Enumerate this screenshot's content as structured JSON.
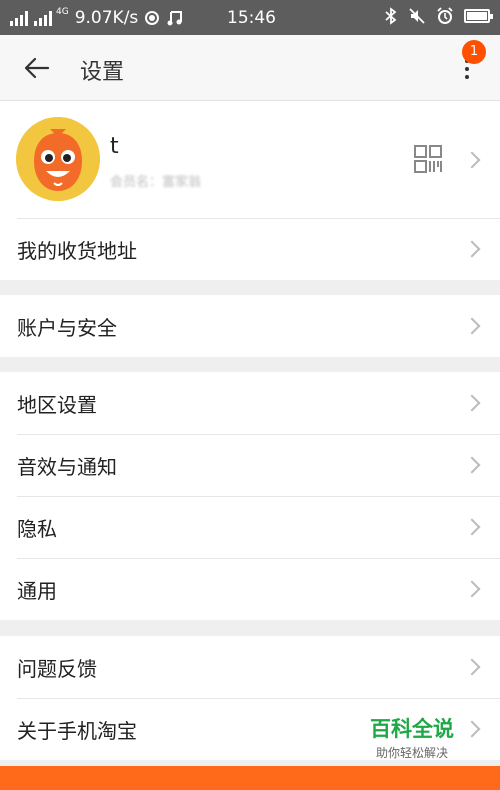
{
  "status_bar": {
    "network_4g": "4G",
    "speed": "9.07K/s",
    "time": "15:46"
  },
  "title_bar": {
    "title": "设置",
    "badge_count": "1"
  },
  "profile": {
    "name": "t",
    "subtitle": "会员名：富家翁"
  },
  "sections": [
    {
      "items": [
        {
          "label": "我的收货地址"
        }
      ]
    },
    {
      "items": [
        {
          "label": "账户与安全"
        }
      ]
    },
    {
      "items": [
        {
          "label": "地区设置"
        },
        {
          "label": "音效与通知"
        },
        {
          "label": "隐私"
        },
        {
          "label": "通用"
        }
      ]
    },
    {
      "items": [
        {
          "label": "问题反馈"
        },
        {
          "label": "关于手机淘宝"
        }
      ]
    }
  ],
  "watermark": {
    "title": "百科全说",
    "subtitle": "助你轻松解决"
  },
  "colors": {
    "accent": "#ff5000",
    "watermark_green": "#1fa846",
    "status_bar": "#5d5d5d"
  }
}
